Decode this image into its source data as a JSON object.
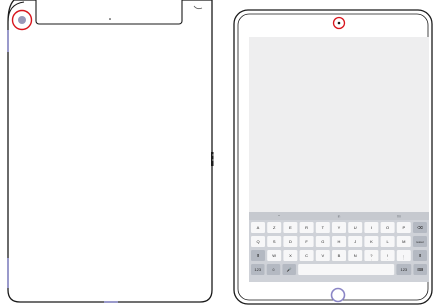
{
  "figure": {
    "highlight_color": "#d8141c",
    "device_outline_color": "#1a1a1a",
    "screen_color": "#eeeeef",
    "keyboard_color": "#cfd2d8",
    "key_color": "#f7f7f8",
    "special_key_color": "#b4b9c2",
    "side_button_color": "#9a9acb",
    "home_button_color": "#8b86c6",
    "rear_camera_color": "#9a98b8"
  },
  "rear_view": {
    "camera_icon": "rear-camera-lens",
    "highlighted_part": "rear-camera"
  },
  "front_view": {
    "camera_icon": "front-camera-lens",
    "highlighted_part": "front-camera",
    "home_button_icon": "home-button-ring"
  },
  "keyboard": {
    "suggestion_bar": [
      "\"\"",
      "in",
      "I'm"
    ],
    "rows": [
      [
        "A",
        "Z",
        "E",
        "R",
        "T",
        "Y",
        "U",
        "I",
        "O",
        "P",
        "⌫"
      ],
      [
        "Q",
        "S",
        "D",
        "F",
        "G",
        "H",
        "J",
        "K",
        "L",
        "M",
        "retour"
      ],
      [
        "⬆",
        "W",
        "X",
        "C",
        "V",
        "B",
        "N",
        "?",
        "!",
        ";",
        "⬆"
      ],
      [
        "123",
        "☺",
        "🎤",
        "",
        "123",
        "⌨"
      ]
    ],
    "row2_sub": [
      "",
      "",
      "",
      "",
      "",
      "",
      "",
      ",",
      ".",
      ":",
      ""
    ]
  }
}
